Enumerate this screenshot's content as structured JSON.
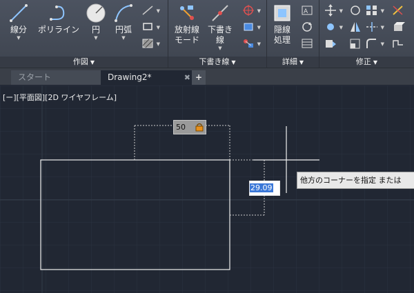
{
  "ribbon": {
    "draw_panel": {
      "title": "作図",
      "buttons": [
        {
          "label": "線分",
          "icon": "line-icon"
        },
        {
          "label": "ポリライン",
          "icon": "polyline-icon"
        },
        {
          "label": "円",
          "icon": "circle-icon"
        },
        {
          "label": "円弧",
          "icon": "arc-icon"
        }
      ]
    },
    "sketch_panel": {
      "title": "下書き線",
      "buttons": [
        {
          "label_line1": "放射線",
          "label_line2": "モード",
          "icon": "radial-line-icon"
        },
        {
          "label_line1": "下書き",
          "label_line2": "線",
          "icon": "construction-line-icon"
        }
      ]
    },
    "detail_panel": {
      "title": "詳細",
      "buttons": [
        {
          "label_line1": "隠線",
          "label_line2": "処理",
          "icon": "hidden-line-icon"
        }
      ]
    },
    "modify_panel": {
      "title": "修正"
    }
  },
  "tabs": {
    "start": "スタート",
    "active": "Drawing2*",
    "close": "✖",
    "add": "+"
  },
  "viewport": {
    "label": "[ー][平面図][2D ワイヤフレーム]"
  },
  "dimension_inputs": {
    "width": "50",
    "height": "29.09"
  },
  "tooltip": "他方のコーナーを指定 または",
  "colors": {
    "canvas": "#212733",
    "ribbon": "#434955",
    "grid": "#2c3340",
    "selection": "#3b78d8"
  }
}
